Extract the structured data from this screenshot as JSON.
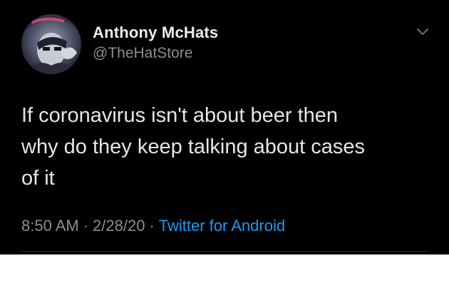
{
  "tweet": {
    "display_name": "Anthony McHats",
    "handle": "@TheHatStore",
    "text": "If coronavirus isn't about beer then\nwhy do they keep talking about cases\nof it",
    "time": "8:50 AM",
    "date": "2/28/20",
    "separator": "·",
    "source": "Twitter for Android"
  },
  "icons": {
    "avatar": "avatar",
    "more": "chevron-down-icon"
  },
  "colors": {
    "background": "#000000",
    "link": "#1d9bf0",
    "muted": "#8a8d91"
  }
}
